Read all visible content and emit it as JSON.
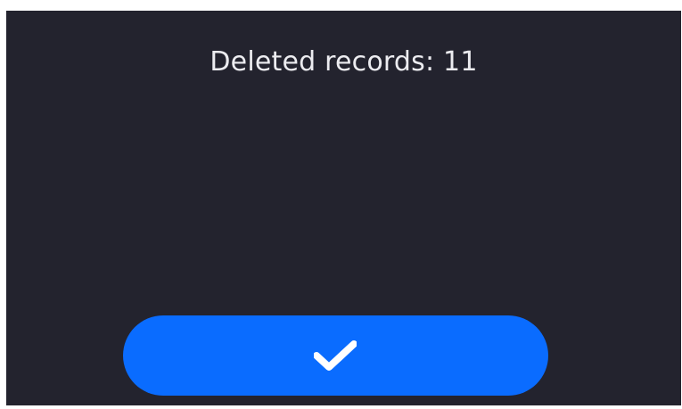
{
  "dialog": {
    "message": "Deleted records: 11"
  },
  "confirm_button": {
    "icon": "check-icon"
  },
  "colors": {
    "background": "#23232e",
    "text": "#ececf0",
    "accent": "#0a6cff",
    "icon": "#ffffff"
  }
}
